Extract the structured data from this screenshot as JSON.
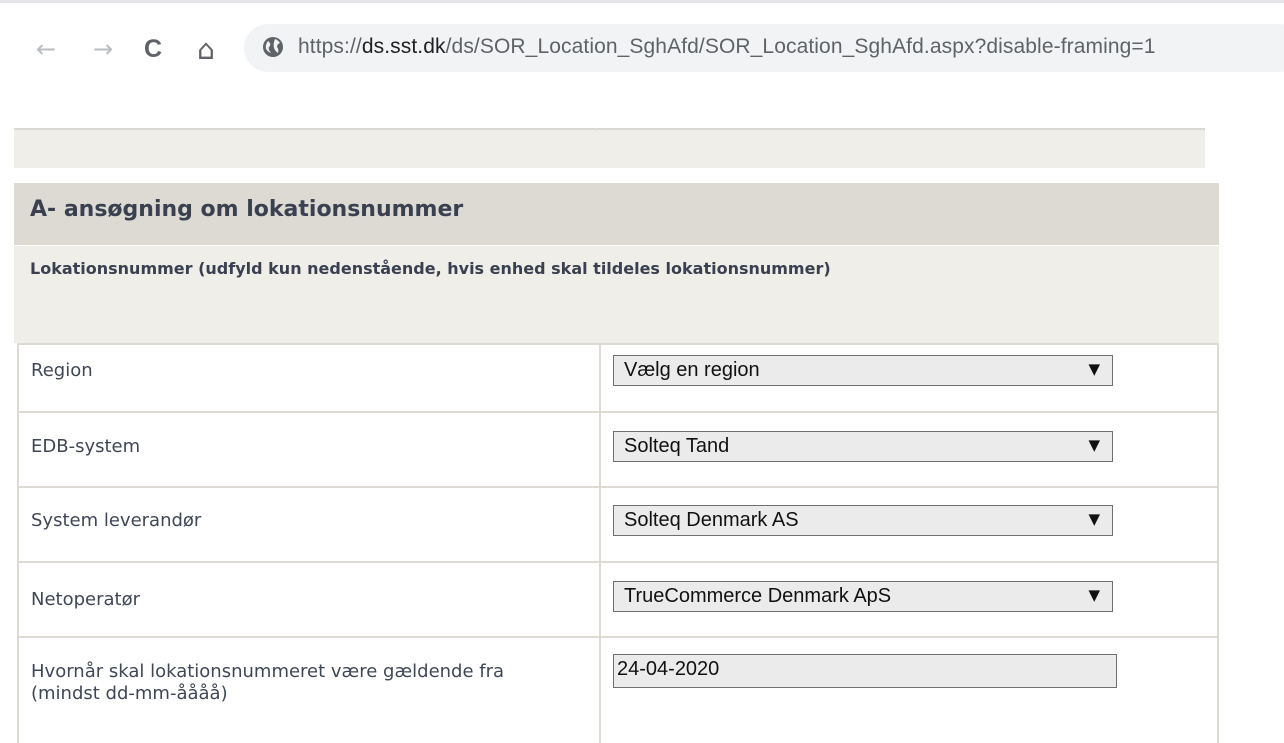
{
  "browser": {
    "back_icon": "←",
    "forward_icon": "→",
    "reload_icon": "C",
    "home_icon": "⌂",
    "url_prefix": "https://",
    "url_host": "ds.sst.dk",
    "url_path": "/ds/SOR_Location_SghAfd/SOR_Location_SghAfd.aspx?disable-framing=1"
  },
  "section": {
    "title": "A- ansøgning om lokationsnummer",
    "subtitle": "Lokationsnummer (udfyld kun nedenstående, hvis enhed skal tildeles lokationsnummer)"
  },
  "form": {
    "region": {
      "label": "Region",
      "value": "Vælg en region"
    },
    "edb": {
      "label": "EDB-system",
      "value": "Solteq Tand"
    },
    "supplier": {
      "label": "System leverandør",
      "value": "Solteq Denmark AS"
    },
    "netoperator": {
      "label": "Netoperatør",
      "value": "TrueCommerce Denmark ApS"
    },
    "valid_from": {
      "label_line1": "Hvornår skal lokationsnummeret være gældende fra",
      "label_line2": "(mindst dd-mm-åååå)",
      "value": "24-04-2020"
    },
    "dropdown_arrow": "▼"
  },
  "colors": {
    "header_bg": "#dcdad3",
    "section_bg": "#efeee8",
    "text": "#3a4050",
    "field_bg": "#ebebeb"
  }
}
